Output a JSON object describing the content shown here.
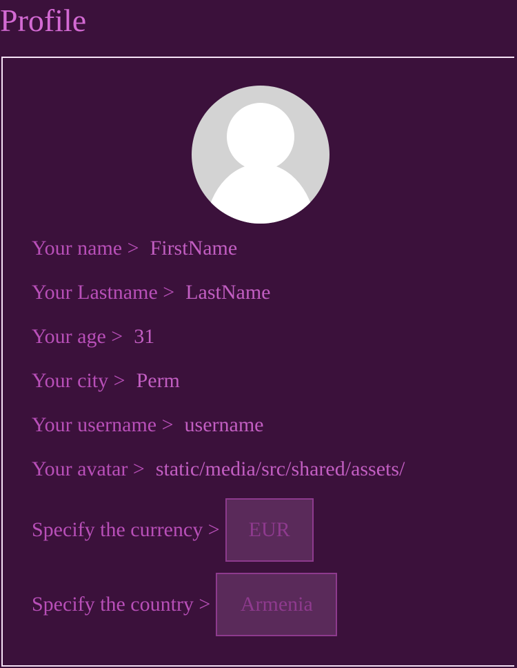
{
  "header": {
    "title": "Profile"
  },
  "profile": {
    "avatar_icon": "user-avatar-icon",
    "fields": {
      "name": {
        "label": "Your name >",
        "value": "FirstName"
      },
      "lastname": {
        "label": "Your Lastname >",
        "value": "LastName"
      },
      "age": {
        "label": "Your age >",
        "value": "31"
      },
      "city": {
        "label": "Your city >",
        "value": "Perm"
      },
      "username": {
        "label": "Your username >",
        "value": "username"
      },
      "avatar": {
        "label": "Your avatar >",
        "value": "static/media/src/shared/assets/"
      }
    },
    "currency": {
      "label": "Specify the currency >",
      "selected": "EUR"
    },
    "country": {
      "label": "Specify the country >",
      "selected": "Armenia"
    }
  },
  "colors": {
    "background": "#3b113b",
    "accent": "#c154c1",
    "border": "#f7e4f7",
    "select_bg": "#5a2a5a"
  }
}
